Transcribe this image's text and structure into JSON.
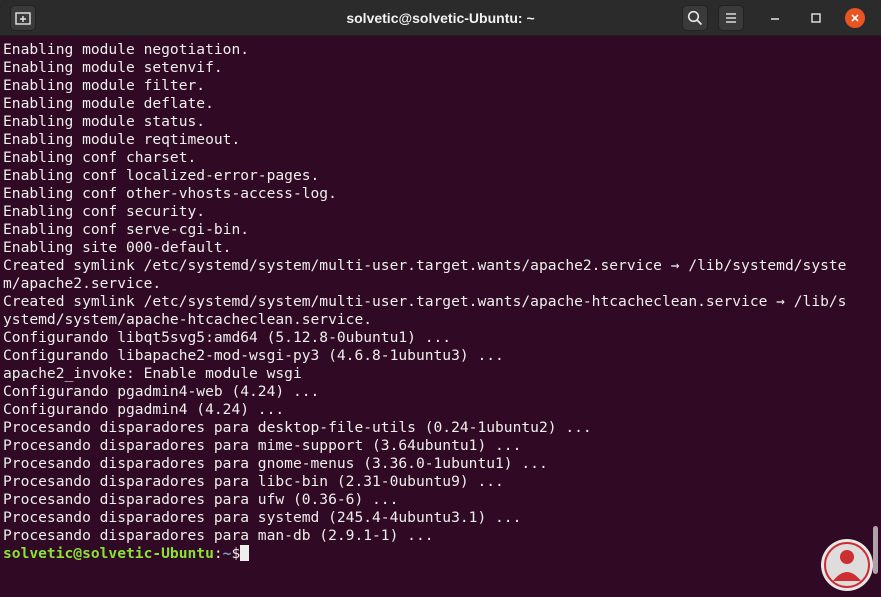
{
  "window": {
    "title": "solvetic@solvetic-Ubuntu: ~"
  },
  "titlebar": {
    "icons": {
      "new_tab": "new-tab-icon",
      "search": "search-icon",
      "menu": "hamburger-menu-icon",
      "minimize": "minimize-icon",
      "maximize": "maximize-icon",
      "close": "close-icon"
    }
  },
  "terminal": {
    "lines": [
      "Enabling module negotiation.",
      "Enabling module setenvif.",
      "Enabling module filter.",
      "Enabling module deflate.",
      "Enabling module status.",
      "Enabling module reqtimeout.",
      "Enabling conf charset.",
      "Enabling conf localized-error-pages.",
      "Enabling conf other-vhosts-access-log.",
      "Enabling conf security.",
      "Enabling conf serve-cgi-bin.",
      "Enabling site 000-default.",
      "Created symlink /etc/systemd/system/multi-user.target.wants/apache2.service → /lib/systemd/syste",
      "m/apache2.service.",
      "Created symlink /etc/systemd/system/multi-user.target.wants/apache-htcacheclean.service → /lib/s",
      "ystemd/system/apache-htcacheclean.service.",
      "Configurando libqt5svg5:amd64 (5.12.8-0ubuntu1) ...",
      "Configurando libapache2-mod-wsgi-py3 (4.6.8-1ubuntu3) ...",
      "apache2_invoke: Enable module wsgi",
      "Configurando pgadmin4-web (4.24) ...",
      "Configurando pgadmin4 (4.24) ...",
      "Procesando disparadores para desktop-file-utils (0.24-1ubuntu2) ...",
      "Procesando disparadores para mime-support (3.64ubuntu1) ...",
      "Procesando disparadores para gnome-menus (3.36.0-1ubuntu1) ...",
      "Procesando disparadores para libc-bin (2.31-0ubuntu9) ...",
      "Procesando disparadores para ufw (0.36-6) ...",
      "Procesando disparadores para systemd (245.4-4ubuntu3.1) ...",
      "Procesando disparadores para man-db (2.9.1-1) ..."
    ],
    "prompt": {
      "user_host": "solvetic@solvetic-Ubuntu",
      "separator": ":",
      "path": "~",
      "symbol": "$"
    }
  },
  "colors": {
    "terminal_bg": "#300a24",
    "titlebar_bg": "#2b2b2b",
    "text": "#eeeeec",
    "prompt_user": "#8ae234",
    "prompt_path": "#729fcf",
    "close_button": "#e95420"
  },
  "watermark": {
    "icon": "solvetic-logo-icon"
  }
}
